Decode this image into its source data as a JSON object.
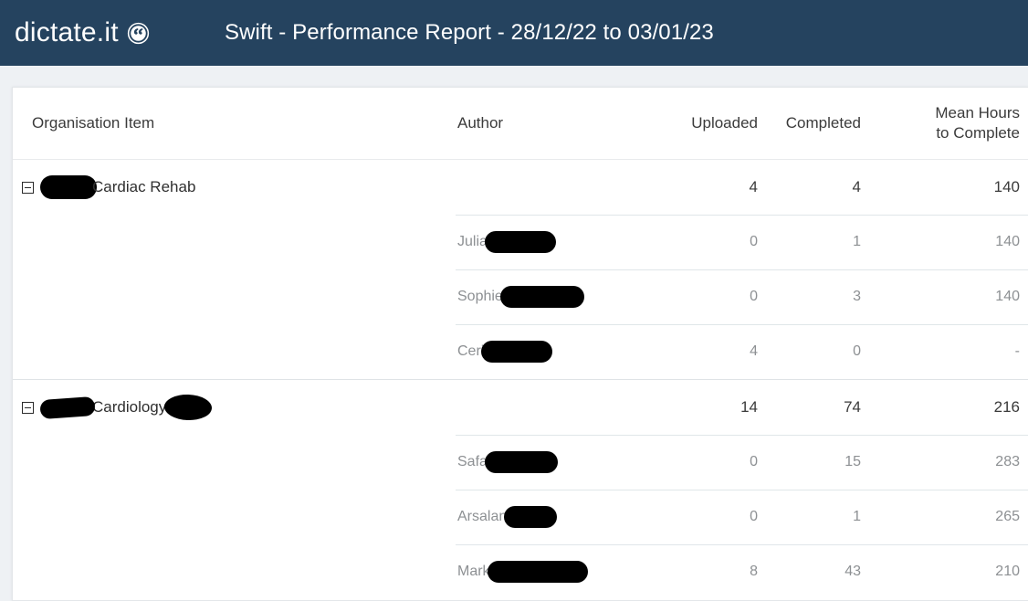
{
  "header": {
    "brand_text": "dictate.it",
    "brand_icon": "dictate-circle-icon",
    "report_title": "Swift - Performance Report - 28/12/22 to 03/01/23",
    "background_color": "#25435f"
  },
  "table": {
    "columns": [
      {
        "key": "organisation_item",
        "label": "Organisation Item",
        "align": "left"
      },
      {
        "key": "author",
        "label": "Author",
        "align": "left"
      },
      {
        "key": "uploaded",
        "label": "Uploaded",
        "align": "right"
      },
      {
        "key": "completed",
        "label": "Completed",
        "align": "right"
      },
      {
        "key": "mean_hours",
        "label_line1": "Mean Hours",
        "label_line2": "to Complete",
        "align": "right"
      }
    ],
    "groups": [
      {
        "name": "Cardiac Rehab",
        "redacted_prefix": true,
        "redacted_suffix": false,
        "expanded": true,
        "toggle_icon": "minus-box-icon",
        "uploaded": "4",
        "completed": "4",
        "mean_hours": "140",
        "rows": [
          {
            "author": "Julia",
            "redacted_surname": true,
            "redact_width": 78,
            "uploaded": "0",
            "completed": "1",
            "mean_hours": "140"
          },
          {
            "author": "Sophie",
            "redacted_surname": true,
            "redact_width": 92,
            "uploaded": "0",
            "completed": "3",
            "mean_hours": "140"
          },
          {
            "author": "Ceri",
            "redacted_surname": true,
            "redact_width": 78,
            "uploaded": "4",
            "completed": "0",
            "mean_hours": "-"
          }
        ]
      },
      {
        "name": "Cardiology",
        "redacted_prefix": true,
        "redacted_suffix": true,
        "expanded": true,
        "toggle_icon": "minus-box-icon",
        "uploaded": "14",
        "completed": "74",
        "mean_hours": "216",
        "rows": [
          {
            "author": "Safa",
            "redacted_surname": true,
            "redact_width": 80,
            "uploaded": "0",
            "completed": "15",
            "mean_hours": "283"
          },
          {
            "author": "Arsalan",
            "redacted_surname": true,
            "redact_width": 58,
            "uploaded": "0",
            "completed": "1",
            "mean_hours": "265"
          },
          {
            "author": "Mark",
            "redacted_surname": true,
            "redact_width": 110,
            "uploaded": "8",
            "completed": "43",
            "mean_hours": "210"
          }
        ]
      }
    ]
  }
}
